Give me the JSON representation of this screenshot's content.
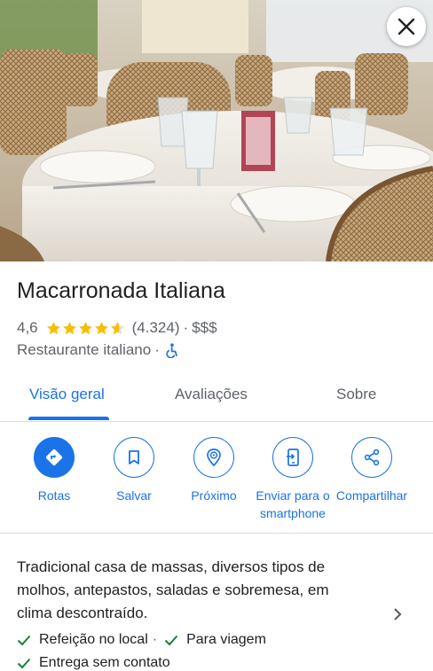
{
  "place": {
    "name": "Macarronada Italiana",
    "rating": "4,6",
    "stars_value": 4.6,
    "review_count": "(4.324)",
    "separator": "·",
    "price_level": "$$$",
    "category": "Restaurante italiano",
    "accessibility_icon": "wheelchair-icon"
  },
  "tabs": [
    {
      "label": "Visão geral",
      "active": true
    },
    {
      "label": "Avaliações",
      "active": false
    },
    {
      "label": "Sobre",
      "active": false
    }
  ],
  "actions": [
    {
      "label": "Rotas",
      "icon": "directions-icon"
    },
    {
      "label": "Salvar",
      "icon": "bookmark-icon"
    },
    {
      "label": "Próximo",
      "icon": "nearby-icon"
    },
    {
      "label_line1": "Enviar para o",
      "label_line2": "smartphone",
      "icon": "send-to-phone-icon"
    },
    {
      "label": "Compartilhar",
      "icon": "share-icon"
    }
  ],
  "about": {
    "description": "Tradicional casa de massas, diversos tipos de molhos, antepastos, saladas e sobremesa, em clima descontraído.",
    "features": [
      "Refeição no local",
      "Para viagem",
      "Entrega sem contato"
    ]
  },
  "colors": {
    "accent": "#1a73e8",
    "star": "#fbbc04",
    "check": "#188038",
    "text_secondary": "#5f6368"
  }
}
